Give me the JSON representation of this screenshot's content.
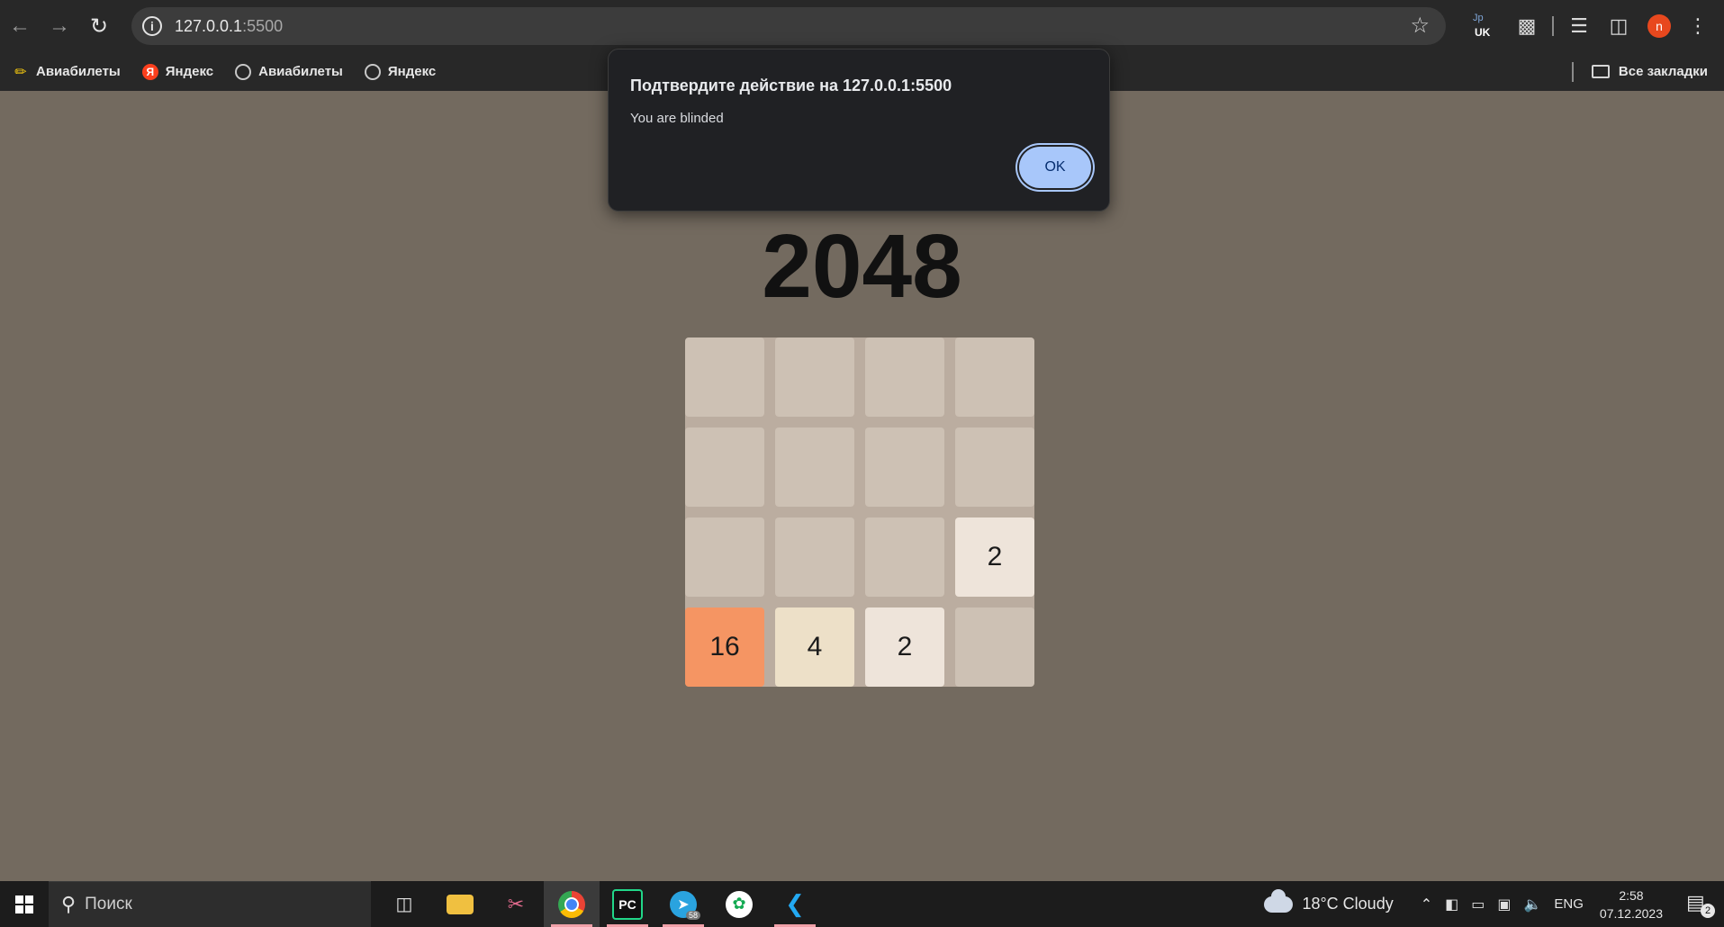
{
  "browser": {
    "url_host": "127.0.0.1",
    "url_port": ":5500",
    "extension_badge": "UK",
    "extension_top": "Jp",
    "profile_initial": "n"
  },
  "bookmarks": {
    "items": [
      {
        "label": "Авиабилеты",
        "icon": "pencil-icon"
      },
      {
        "label": "Яндекс",
        "icon": "yandex-icon"
      },
      {
        "label": "Авиабилеты",
        "icon": "globe-icon"
      },
      {
        "label": "Яндекс",
        "icon": "globe-icon"
      }
    ],
    "all_bookmarks_label": "Все закладки"
  },
  "game": {
    "title": "2048",
    "grid": [
      [
        "",
        "",
        "",
        ""
      ],
      [
        "",
        "",
        "",
        ""
      ],
      [
        "",
        "",
        "",
        "2"
      ],
      [
        "16",
        "4",
        "2",
        ""
      ]
    ],
    "colors": {
      "board": "#bbada0",
      "empty": "#cdc1b4",
      "2": "#eee4da",
      "4": "#ede0c8",
      "16": "#f59563"
    }
  },
  "dialog": {
    "title": "Подтвердите действие на 127.0.0.1:5500",
    "message": "You are blinded",
    "ok_label": "OK"
  },
  "taskbar": {
    "search_placeholder": "Поиск",
    "apps": [
      "task-view",
      "file-explorer",
      "snipping-tool",
      "chrome",
      "pycharm",
      "telegram",
      "mongodb-compass",
      "vscode"
    ],
    "telegram_badge": "58",
    "weather": "18°C  Cloudy",
    "language": "ENG",
    "time": "2:58",
    "date": "07.12.2023",
    "notification_count": "2"
  }
}
